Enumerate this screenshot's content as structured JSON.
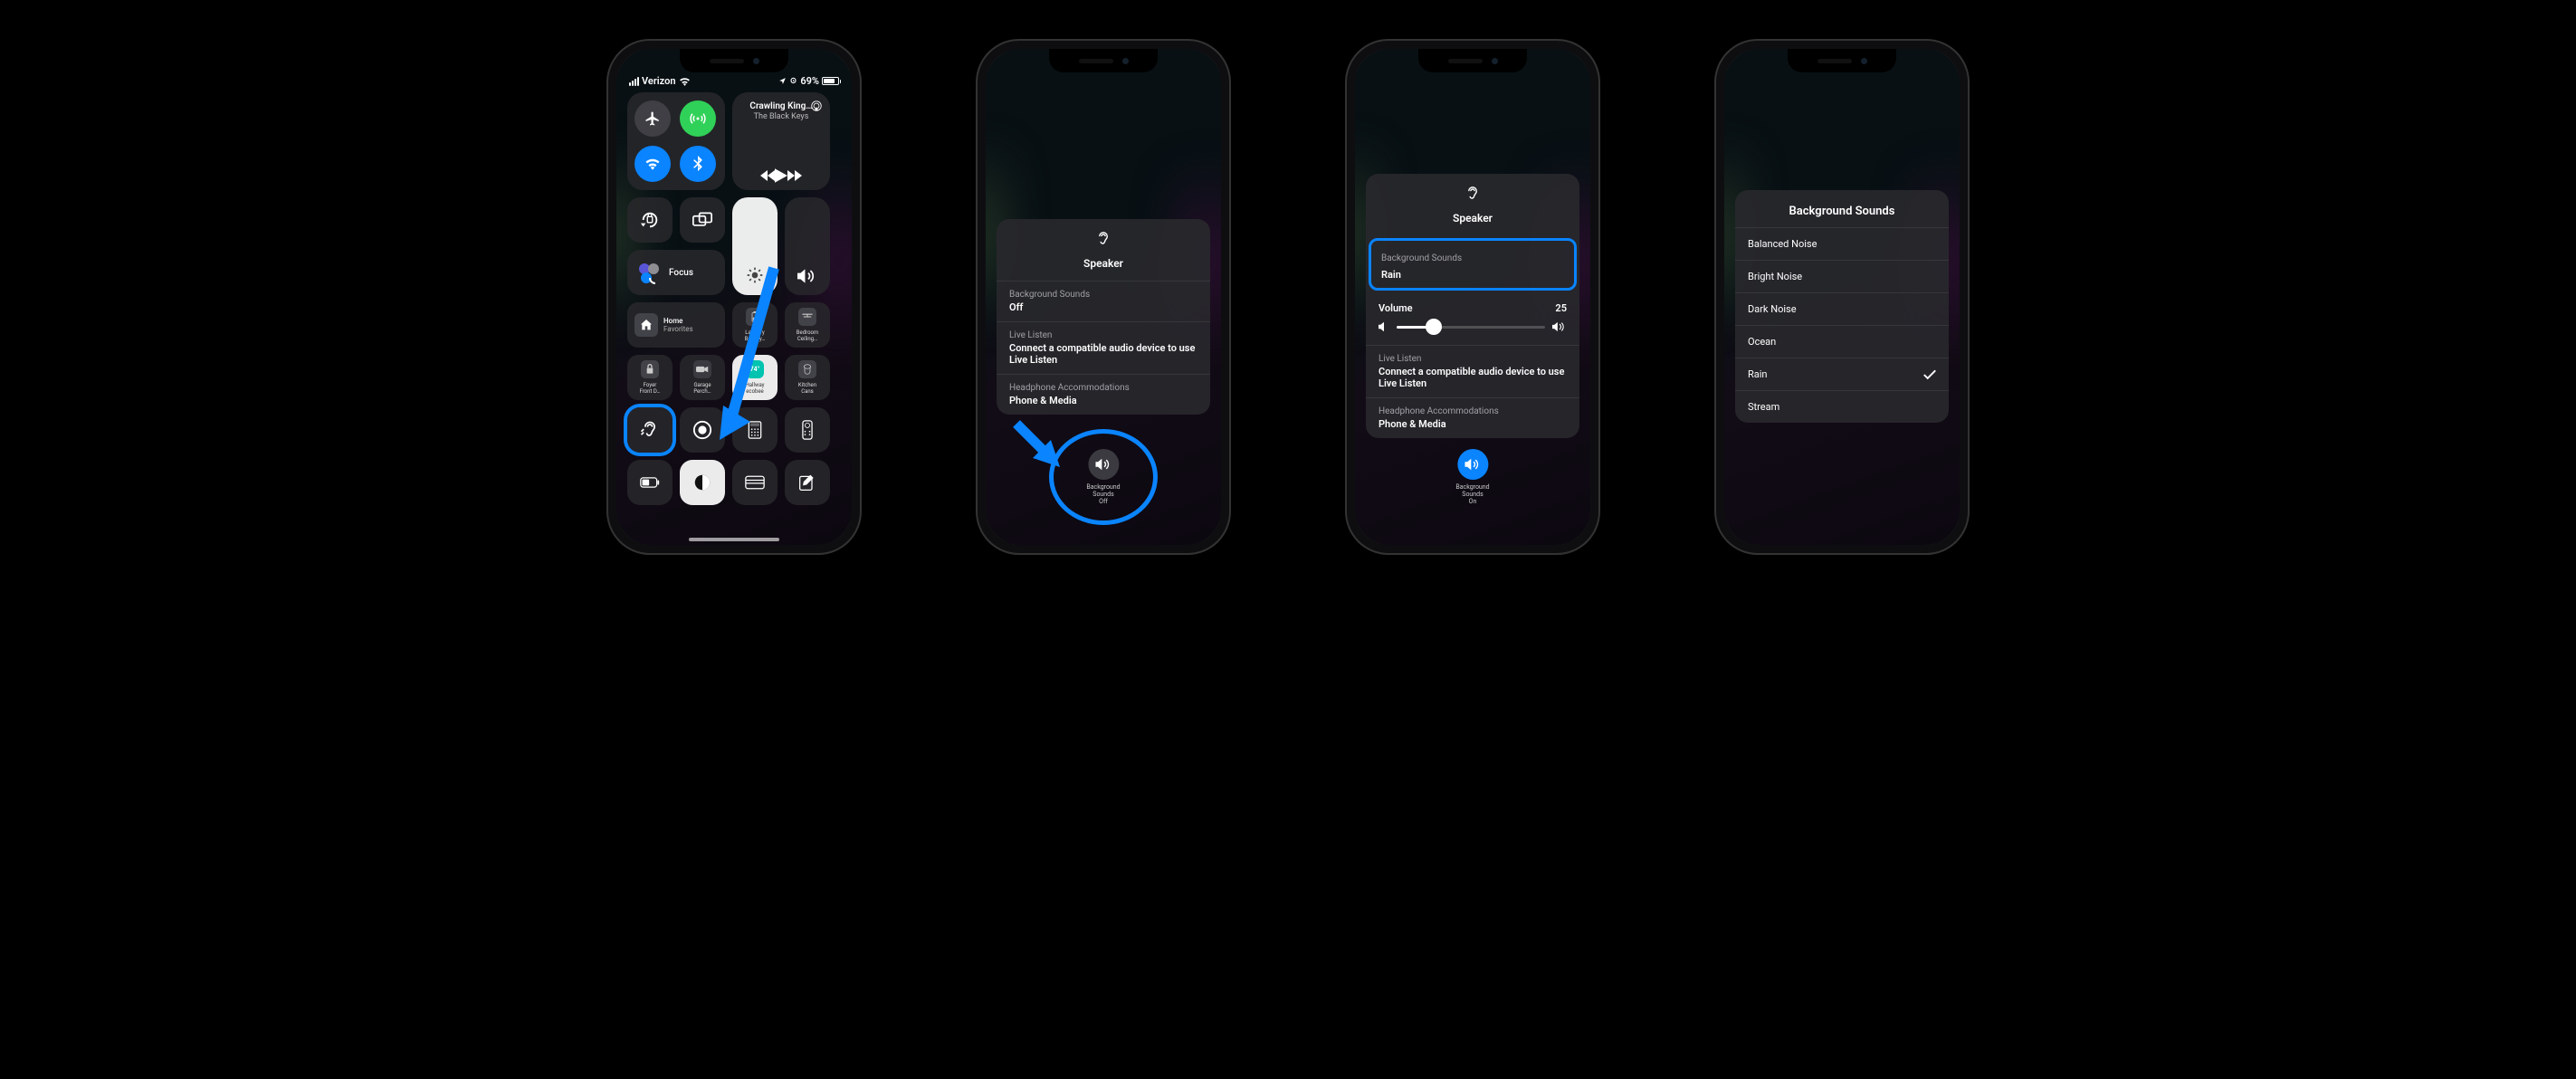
{
  "phone1": {
    "status": {
      "carrier": "Verizon",
      "batteryPct": "69%"
    },
    "media": {
      "title": "Crawling King…",
      "artist": "The Black Keys"
    },
    "focus": "Focus",
    "home": {
      "favorites": {
        "l1": "Home",
        "l2": "Favorites"
      },
      "laundry": {
        "l1": "Laundry",
        "l2": "Battery…"
      },
      "bedroom": {
        "l1": "Bedroom",
        "l2": "Ceiling…"
      },
      "foyer": {
        "l1": "Foyer",
        "l2": "Front D…"
      },
      "garage": {
        "l1": "Garage",
        "l2": "Perch…"
      },
      "hallway": {
        "l1": "Hallway",
        "l2": "ecobee",
        "temp": "74°"
      },
      "kitchen": {
        "l1": "Kitchen",
        "l2": "Cans"
      }
    }
  },
  "hearing": {
    "speaker": "Speaker",
    "bgSoundsLabel": "Background Sounds",
    "off": "Off",
    "rain": "Rain",
    "volumeLabel": "Volume",
    "volumeValue": "25",
    "liveListen": "Live Listen",
    "liveListenHelp": "Connect a compatible audio device to use Live Listen",
    "headphoneAcc": "Headphone Accommodations",
    "phoneMedia": "Phone & Media",
    "btn": {
      "label1": "Background",
      "label2": "Sounds",
      "off": "Off",
      "on": "On"
    }
  },
  "sounds": {
    "title": "Background Sounds",
    "items": [
      "Balanced Noise",
      "Bright Noise",
      "Dark Noise",
      "Ocean",
      "Rain",
      "Stream"
    ],
    "selected": "Rain"
  }
}
